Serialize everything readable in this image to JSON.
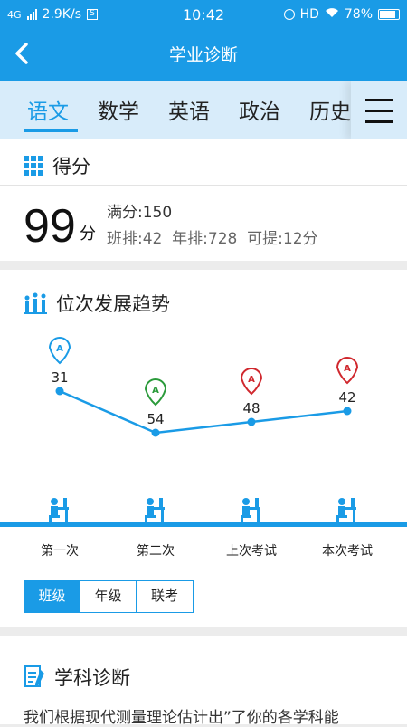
{
  "status": {
    "network": "4G",
    "speed": "2.9K/s",
    "time": "10:42",
    "hd": "HD",
    "battery": "78%"
  },
  "nav": {
    "back_icon": "chevron-left-icon",
    "title": "学业诊断"
  },
  "tabs": [
    {
      "label": "语文",
      "active": true
    },
    {
      "label": "数学",
      "active": false
    },
    {
      "label": "英语",
      "active": false
    },
    {
      "label": "政治",
      "active": false
    },
    {
      "label": "历史",
      "active": false
    }
  ],
  "score": {
    "heading": "得分",
    "value": "99",
    "unit": "分",
    "full": "满分:150",
    "rank_line": "班排:42  年排:728  可提:12分"
  },
  "trend": {
    "heading": "位次发展趋势",
    "points": [
      {
        "label": "第一次",
        "rank": "31",
        "badge": "A",
        "badge_color": "#1a9be6"
      },
      {
        "label": "第二次",
        "rank": "54",
        "badge": "A",
        "badge_color": "#2a9a3a"
      },
      {
        "label": "上次考试",
        "rank": "48",
        "badge": "A",
        "badge_color": "#d0282e"
      },
      {
        "label": "本次考试",
        "rank": "42",
        "badge": "A",
        "badge_color": "#d0282e"
      }
    ],
    "segments": [
      {
        "label": "班级",
        "active": true
      },
      {
        "label": "年级",
        "active": false
      },
      {
        "label": "联考",
        "active": false
      }
    ]
  },
  "diagnosis": {
    "heading": "学科诊断",
    "text": "我们根据现代测量理论估计出”了你的各学科能"
  },
  "colors": {
    "primary": "#1a9be6",
    "tab_bg": "#d8ecfa",
    "badge_green": "#2a9a3a",
    "badge_red": "#d0282e"
  }
}
